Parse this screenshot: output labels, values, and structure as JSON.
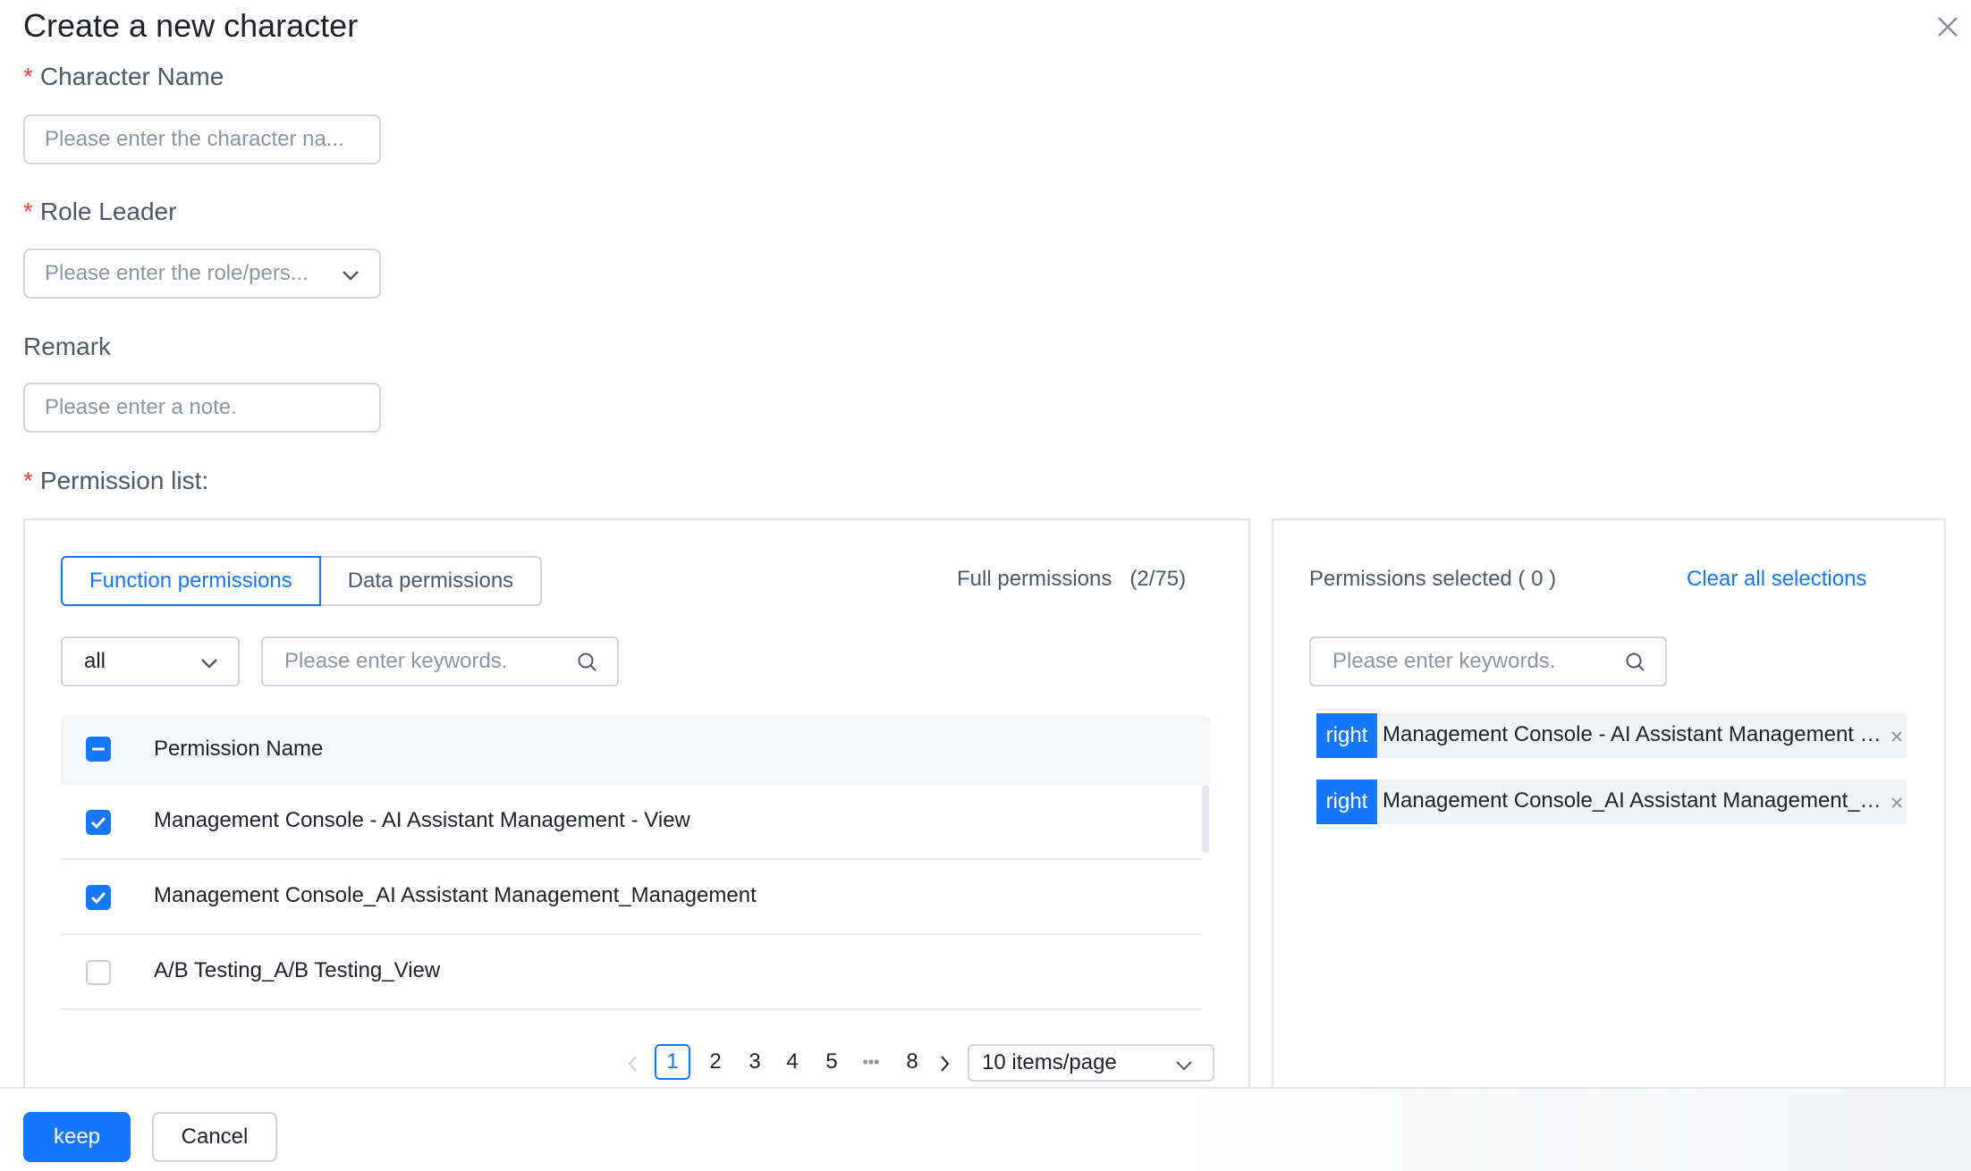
{
  "dialog": {
    "title": "Create a new character"
  },
  "form": {
    "character_name": {
      "label": "Character Name",
      "placeholder": "Please enter the character na..."
    },
    "role_leader": {
      "label": "Role Leader",
      "placeholder": "Please enter the role/pers..."
    },
    "remark": {
      "label": "Remark",
      "placeholder": "Please enter a note."
    },
    "permission_list_label": "Permission list:"
  },
  "permissions": {
    "tabs": [
      "Function permissions",
      "Data permissions"
    ],
    "full_permissions": "Full permissions   (2/75)",
    "filter_value": "all",
    "search_placeholder": "Please enter keywords.",
    "column_header": "Permission Name",
    "rows": [
      {
        "name": "Management Console - AI Assistant Management - View",
        "checked": true
      },
      {
        "name": "Management Console_AI Assistant Management_Management",
        "checked": true
      },
      {
        "name": "A/B Testing_A/B Testing_View",
        "checked": false
      }
    ],
    "pagination": {
      "current": "1",
      "pages": [
        "2",
        "3",
        "4",
        "5"
      ],
      "ellipsis": "•••",
      "last": "8",
      "page_size": "10 items/page"
    }
  },
  "selected": {
    "header": "Permissions selected ( 0 )",
    "clear_label": "Clear all selections",
    "search_placeholder": "Please enter keywords.",
    "items": [
      {
        "tag": "right",
        "name": "Management Console - AI Assistant Management - View"
      },
      {
        "tag": "right",
        "name": "Management Console_AI Assistant Management_Management"
      }
    ]
  },
  "footer": {
    "keep_label": "keep",
    "cancel_label": "Cancel"
  },
  "colors": {
    "primary": "#1677ff",
    "required": "#f53f3f"
  }
}
